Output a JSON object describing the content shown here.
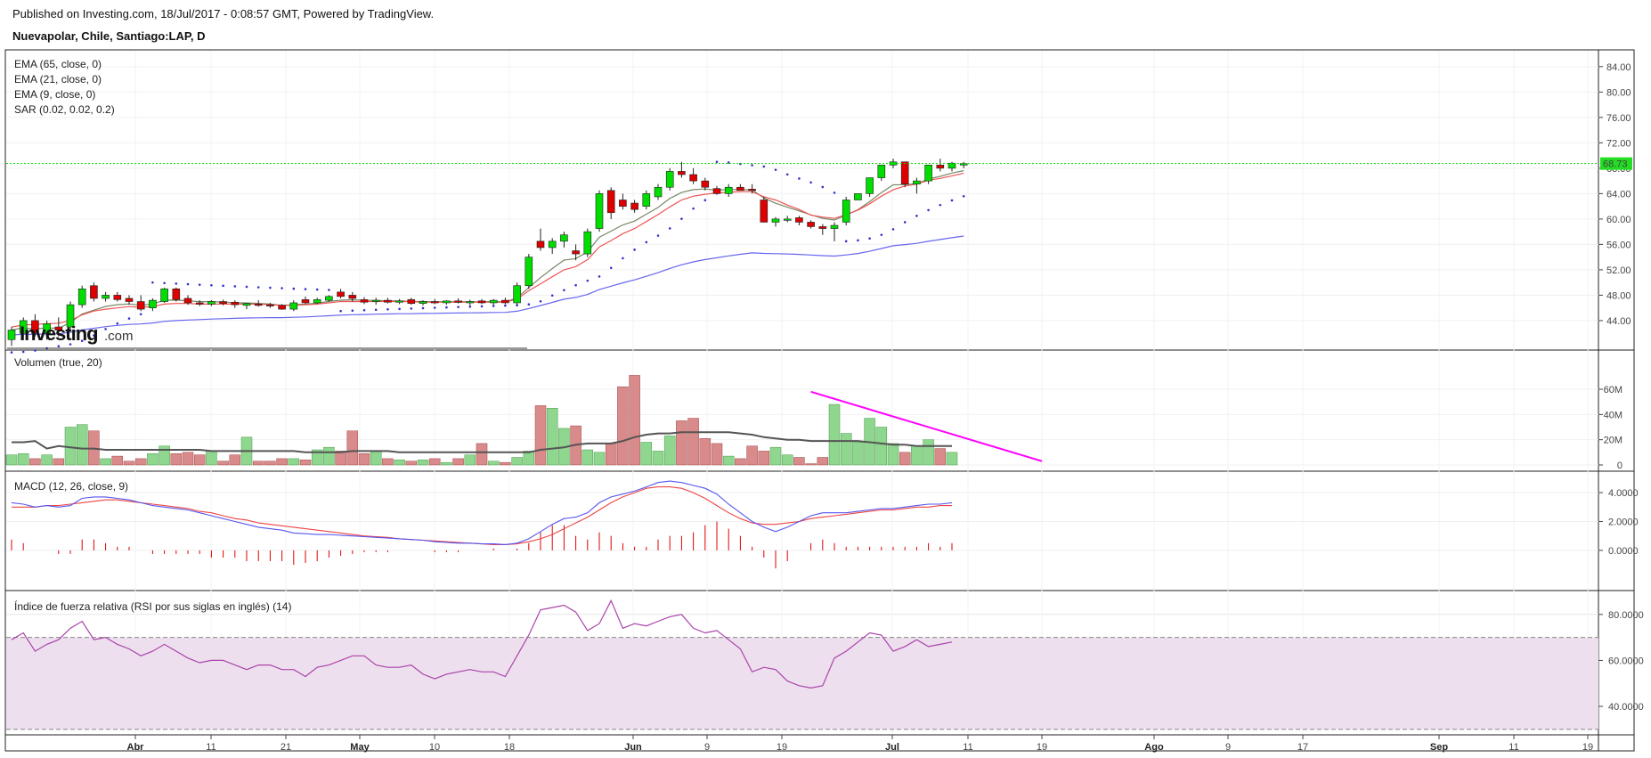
{
  "header": {
    "published": "Published on Investing.com, 18/Jul/2017 - 0:08:57 GMT, Powered by TradingView.",
    "instrument": "Nuevapolar, Chile, Santiago:LAP, D"
  },
  "logo": {
    "brand": "Investing",
    "suffix": ".com"
  },
  "colors": {
    "up": "#00dd00",
    "down": "#dd0000",
    "ema65": "#6666ee",
    "ema21": "#778866",
    "ema9": "#ee5555",
    "sar": "#3333cc",
    "vol_up": "#8fd68f",
    "vol_down": "#d98a8a",
    "vol_ma": "#555555",
    "trendline": "#ff00ff",
    "macd": "#5555ee",
    "signal": "#ee4444",
    "rsi": "#aa44aa",
    "rsi_band": "#eddfee",
    "last_price_bg": "#22dd22"
  },
  "chart_data": [
    {
      "type": "candlestick",
      "title": "Nuevapolar, Chile, Santiago:LAP, D",
      "legend": [
        "EMA (65, close, 0)",
        "EMA (21, close, 0)",
        "EMA (9, close, 0)",
        "SAR (0.02, 0.02, 0.2)"
      ],
      "y_ticks": [
        "84.00",
        "80.00",
        "76.00",
        "72.00",
        "68.00",
        "64.00",
        "60.00",
        "56.00",
        "52.00",
        "48.00",
        "44.00"
      ],
      "ylim": [
        39.5,
        86.5
      ],
      "last_price": 68.73,
      "last_price_label": "68.73",
      "candles": [
        {
          "o": 41,
          "h": 43,
          "l": 40,
          "c": 42.5
        },
        {
          "o": 42,
          "h": 44.5,
          "l": 41,
          "c": 44
        },
        {
          "o": 44,
          "h": 45,
          "l": 41.5,
          "c": 42
        },
        {
          "o": 42,
          "h": 44,
          "l": 41,
          "c": 43.5
        },
        {
          "o": 43,
          "h": 44.5,
          "l": 41.5,
          "c": 42.5
        },
        {
          "o": 43,
          "h": 47,
          "l": 42.5,
          "c": 46.5
        },
        {
          "o": 46.5,
          "h": 49.5,
          "l": 46,
          "c": 49
        },
        {
          "o": 49.5,
          "h": 50,
          "l": 47,
          "c": 47.5
        },
        {
          "o": 47.5,
          "h": 48.5,
          "l": 47,
          "c": 48
        },
        {
          "o": 48,
          "h": 48.5,
          "l": 47,
          "c": 47.3
        },
        {
          "o": 47.5,
          "h": 48,
          "l": 46.5,
          "c": 47
        },
        {
          "o": 47,
          "h": 48,
          "l": 45.5,
          "c": 45.8
        },
        {
          "o": 46,
          "h": 47.5,
          "l": 45.5,
          "c": 47.2
        },
        {
          "o": 47,
          "h": 49.2,
          "l": 46.8,
          "c": 49
        },
        {
          "o": 49,
          "h": 49.2,
          "l": 47,
          "c": 47.3
        },
        {
          "o": 47.5,
          "h": 48,
          "l": 46.5,
          "c": 46.8
        },
        {
          "o": 46.8,
          "h": 47.2,
          "l": 46.3,
          "c": 46.6
        },
        {
          "o": 46.6,
          "h": 47.2,
          "l": 46.3,
          "c": 47
        },
        {
          "o": 47,
          "h": 47.3,
          "l": 46.4,
          "c": 46.7
        },
        {
          "o": 46.9,
          "h": 47.2,
          "l": 46,
          "c": 46.5
        },
        {
          "o": 46.4,
          "h": 46.8,
          "l": 45.8,
          "c": 46.7
        },
        {
          "o": 46.6,
          "h": 47.2,
          "l": 46.2,
          "c": 46.5
        },
        {
          "o": 46.5,
          "h": 46.8,
          "l": 46,
          "c": 46.3
        },
        {
          "o": 46.4,
          "h": 46.6,
          "l": 45.7,
          "c": 45.8
        },
        {
          "o": 45.8,
          "h": 47.2,
          "l": 45.5,
          "c": 46.8
        },
        {
          "o": 47.3,
          "h": 47.8,
          "l": 46.6,
          "c": 46.8
        },
        {
          "o": 46.8,
          "h": 47.6,
          "l": 46.6,
          "c": 47.3
        },
        {
          "o": 47.2,
          "h": 48,
          "l": 47,
          "c": 47.8
        },
        {
          "o": 48.5,
          "h": 49,
          "l": 47.5,
          "c": 47.8
        },
        {
          "o": 48,
          "h": 48.5,
          "l": 47,
          "c": 47.5
        },
        {
          "o": 47.3,
          "h": 47.7,
          "l": 46.6,
          "c": 46.9
        },
        {
          "o": 47,
          "h": 47.6,
          "l": 46.5,
          "c": 47.2
        },
        {
          "o": 47.2,
          "h": 47.6,
          "l": 46.7,
          "c": 46.9
        },
        {
          "o": 47,
          "h": 47.4,
          "l": 46.6,
          "c": 47.1
        },
        {
          "o": 47.3,
          "h": 47.6,
          "l": 46.5,
          "c": 46.7
        },
        {
          "o": 46.7,
          "h": 47.2,
          "l": 46.4,
          "c": 47
        },
        {
          "o": 47,
          "h": 47.4,
          "l": 46.6,
          "c": 46.8
        },
        {
          "o": 46.8,
          "h": 47.2,
          "l": 46.5,
          "c": 47.1
        },
        {
          "o": 47.1,
          "h": 47.5,
          "l": 46.7,
          "c": 46.9
        },
        {
          "o": 46.8,
          "h": 47.3,
          "l": 46.4,
          "c": 47
        },
        {
          "o": 47.1,
          "h": 47.4,
          "l": 46.6,
          "c": 46.8
        },
        {
          "o": 46.8,
          "h": 47.4,
          "l": 46.5,
          "c": 47.2
        },
        {
          "o": 47.2,
          "h": 47.6,
          "l": 46.6,
          "c": 46.8
        },
        {
          "o": 46.8,
          "h": 50,
          "l": 46.5,
          "c": 49.5
        },
        {
          "o": 49.5,
          "h": 54.5,
          "l": 49,
          "c": 54
        },
        {
          "o": 56.5,
          "h": 58.5,
          "l": 55,
          "c": 55.5
        },
        {
          "o": 55.5,
          "h": 57,
          "l": 54.5,
          "c": 56.5
        },
        {
          "o": 56.5,
          "h": 58,
          "l": 55.5,
          "c": 57.5
        },
        {
          "o": 55,
          "h": 56,
          "l": 53.5,
          "c": 54.5
        },
        {
          "o": 54.5,
          "h": 58.5,
          "l": 54,
          "c": 58
        },
        {
          "o": 58.5,
          "h": 64.5,
          "l": 58,
          "c": 64
        },
        {
          "o": 64.5,
          "h": 65,
          "l": 60,
          "c": 61
        },
        {
          "o": 63,
          "h": 64,
          "l": 61.5,
          "c": 62
        },
        {
          "o": 62.5,
          "h": 63,
          "l": 61,
          "c": 61.5
        },
        {
          "o": 62,
          "h": 64.5,
          "l": 61.5,
          "c": 64
        },
        {
          "o": 63.5,
          "h": 65.5,
          "l": 63,
          "c": 65
        },
        {
          "o": 65,
          "h": 68,
          "l": 64.5,
          "c": 67.5
        },
        {
          "o": 67.5,
          "h": 69,
          "l": 66.5,
          "c": 67
        },
        {
          "o": 67,
          "h": 68,
          "l": 65.5,
          "c": 66
        },
        {
          "o": 66,
          "h": 66.5,
          "l": 64.5,
          "c": 65
        },
        {
          "o": 64.8,
          "h": 65.2,
          "l": 63.8,
          "c": 64
        },
        {
          "o": 64,
          "h": 65.5,
          "l": 63.5,
          "c": 65
        },
        {
          "o": 65,
          "h": 65.5,
          "l": 64.5,
          "c": 64.5
        },
        {
          "o": 64.7,
          "h": 65.5,
          "l": 64,
          "c": 64.5
        },
        {
          "o": 63,
          "h": 63.5,
          "l": 59.5,
          "c": 59.5
        },
        {
          "o": 59.5,
          "h": 60.3,
          "l": 58.8,
          "c": 60
        },
        {
          "o": 60,
          "h": 60.5,
          "l": 59.5,
          "c": 60
        },
        {
          "o": 60.2,
          "h": 60.5,
          "l": 59,
          "c": 59.5
        },
        {
          "o": 59.5,
          "h": 59.8,
          "l": 58.5,
          "c": 58.8
        },
        {
          "o": 58.8,
          "h": 59.2,
          "l": 57.5,
          "c": 58.5
        },
        {
          "o": 58.5,
          "h": 59.5,
          "l": 56.5,
          "c": 59
        },
        {
          "o": 59.5,
          "h": 63.5,
          "l": 59,
          "c": 63
        },
        {
          "o": 63,
          "h": 64,
          "l": 63,
          "c": 64
        },
        {
          "o": 64,
          "h": 66.5,
          "l": 63.5,
          "c": 66.5
        },
        {
          "o": 66.5,
          "h": 68.5,
          "l": 66,
          "c": 68.5
        },
        {
          "o": 68.5,
          "h": 69.5,
          "l": 68,
          "c": 69
        },
        {
          "o": 69,
          "h": 69,
          "l": 65,
          "c": 65.5
        },
        {
          "o": 65.5,
          "h": 66.5,
          "l": 64,
          "c": 66
        },
        {
          "o": 66,
          "h": 68.5,
          "l": 65.5,
          "c": 68.5
        },
        {
          "o": 68.5,
          "h": 69.5,
          "l": 67.5,
          "c": 68
        },
        {
          "o": 68,
          "h": 69,
          "l": 67.5,
          "c": 68.8
        },
        {
          "o": 68.5,
          "h": 69,
          "l": 68,
          "c": 68.73
        }
      ],
      "ema9": [
        43,
        43.3,
        43.4,
        43.5,
        43.6,
        44,
        44.9,
        45.5,
        45.8,
        46,
        46.2,
        46.1,
        46.2,
        46.6,
        46.7,
        46.7,
        46.6,
        46.6,
        46.6,
        46.6,
        46.6,
        46.6,
        46.5,
        46.4,
        46.4,
        46.5,
        46.6,
        46.8,
        47,
        47,
        47,
        47,
        47,
        47,
        47,
        46.9,
        46.9,
        46.9,
        46.9,
        46.9,
        46.9,
        46.9,
        46.9,
        47.4,
        48.7,
        49.8,
        50.9,
        52,
        52.5,
        53.6,
        55.6,
        56.6,
        57.7,
        58.5,
        59.6,
        60.7,
        61.9,
        63,
        63.6,
        63.9,
        64.1,
        64.2,
        64.3,
        64.3,
        63.5,
        63,
        62.2,
        61.5,
        60.6,
        60.3,
        60.1,
        60.7,
        61.4,
        62.4,
        63.6,
        64.6,
        65.2,
        65.5,
        66.1,
        66.4,
        66.8,
        67.2
      ]
    },
    {
      "type": "bar",
      "title": "Volumen (true, 20)",
      "y_ticks": [
        "60M",
        "40M",
        "20M",
        "0"
      ],
      "ylim": [
        0,
        72000000
      ],
      "values": [
        8,
        9,
        5,
        8,
        5,
        30,
        32,
        27,
        5,
        7,
        3,
        5,
        9,
        15,
        9,
        10,
        8,
        11,
        3,
        8,
        22,
        3,
        3,
        5,
        5,
        4,
        12,
        14,
        11,
        27,
        9,
        11,
        5,
        4,
        3,
        4,
        5,
        2,
        5,
        8,
        17,
        3,
        2,
        6,
        11,
        47,
        45,
        29,
        31,
        12,
        10,
        17,
        62,
        71,
        18,
        11,
        23,
        35,
        37,
        21,
        17,
        7,
        5,
        15,
        11,
        14,
        8,
        6,
        1,
        6,
        48,
        25,
        18,
        37,
        30,
        17,
        10,
        15,
        20,
        13,
        10
      ],
      "volume_ma": [
        18,
        18,
        19,
        13,
        15,
        14,
        13,
        13,
        12,
        12,
        12,
        12,
        12,
        12,
        12,
        12,
        12,
        11,
        11,
        11,
        11,
        11,
        11,
        11,
        11,
        10,
        10,
        10,
        10,
        11,
        11,
        11,
        11,
        10,
        10,
        10,
        10,
        10,
        10,
        10,
        10,
        10,
        10,
        10,
        10,
        12,
        13,
        14,
        16,
        17,
        17,
        17,
        19,
        22,
        24,
        25,
        25,
        26,
        26,
        26,
        26,
        26,
        25,
        24,
        22,
        21,
        20,
        20,
        19,
        19,
        19,
        19,
        19,
        18,
        17,
        16,
        16,
        15,
        15,
        15,
        15
      ],
      "trendline": {
        "from": 58,
        "to": 3
      }
    },
    {
      "type": "line",
      "title": "MACD (12, 26, close, 9)",
      "y_ticks": [
        "4.0000",
        "2.0000",
        "0.0000"
      ],
      "ylim": [
        -2.6,
        5.3
      ],
      "macd": [
        3.3,
        3.2,
        3.0,
        3.1,
        3.0,
        3.1,
        3.6,
        3.7,
        3.7,
        3.6,
        3.5,
        3.3,
        3.1,
        3.0,
        2.9,
        2.8,
        2.6,
        2.4,
        2.2,
        2.0,
        1.8,
        1.6,
        1.5,
        1.4,
        1.2,
        1.15,
        1.1,
        1.1,
        1.05,
        1.0,
        0.95,
        0.9,
        0.85,
        0.8,
        0.75,
        0.7,
        0.6,
        0.55,
        0.5,
        0.5,
        0.45,
        0.45,
        0.4,
        0.5,
        0.8,
        1.3,
        1.8,
        2.2,
        2.3,
        2.6,
        3.3,
        3.7,
        3.9,
        4.1,
        4.4,
        4.7,
        4.8,
        4.7,
        4.5,
        4.3,
        3.9,
        3.2,
        2.6,
        2.0,
        1.6,
        1.3,
        1.6,
        2.0,
        2.4,
        2.6,
        2.6,
        2.6,
        2.7,
        2.8,
        2.9,
        2.9,
        3.0,
        3.1,
        3.2,
        3.2,
        3.3
      ],
      "signal": [
        3.0,
        3.0,
        3.0,
        3.1,
        3.1,
        3.2,
        3.3,
        3.4,
        3.5,
        3.5,
        3.4,
        3.3,
        3.2,
        3.1,
        3.0,
        2.9,
        2.7,
        2.6,
        2.4,
        2.2,
        2.1,
        1.9,
        1.8,
        1.7,
        1.6,
        1.5,
        1.4,
        1.3,
        1.2,
        1.1,
        1.0,
        0.95,
        0.9,
        0.8,
        0.75,
        0.7,
        0.65,
        0.6,
        0.55,
        0.5,
        0.45,
        0.4,
        0.4,
        0.45,
        0.6,
        0.8,
        1.1,
        1.5,
        1.9,
        2.3,
        2.8,
        3.3,
        3.7,
        4.0,
        4.3,
        4.4,
        4.4,
        4.3,
        4.0,
        3.6,
        3.1,
        2.6,
        2.2,
        1.9,
        1.8,
        1.8,
        1.9,
        2.0,
        2.2,
        2.3,
        2.4,
        2.5,
        2.6,
        2.7,
        2.8,
        2.8,
        2.9,
        3.0,
        3.0,
        3.1,
        3.1
      ],
      "histogram": [
        0.3,
        0.2,
        0,
        0,
        -0.1,
        -0.1,
        0.3,
        0.3,
        0.2,
        0.1,
        0.1,
        0,
        -0.1,
        -0.1,
        -0.1,
        -0.1,
        -0.1,
        -0.2,
        -0.2,
        -0.2,
        -0.3,
        -0.3,
        -0.3,
        -0.3,
        -0.4,
        -0.35,
        -0.3,
        -0.2,
        -0.15,
        -0.1,
        -0.05,
        -0.05,
        -0.05,
        0,
        0,
        0,
        -0.05,
        -0.05,
        -0.05,
        0,
        0,
        0.05,
        0,
        0.05,
        0.2,
        0.5,
        0.7,
        0.7,
        0.4,
        0.3,
        0.5,
        0.4,
        0.2,
        0.1,
        0.1,
        0.3,
        0.4,
        0.4,
        0.5,
        0.7,
        0.8,
        0.6,
        0.4,
        0.1,
        -0.2,
        -0.5,
        -0.3,
        0,
        0.2,
        0.3,
        0.2,
        0.1,
        0.1,
        0.1,
        0.1,
        0.1,
        0.1,
        0.1,
        0.2,
        0.1,
        0.2
      ]
    },
    {
      "type": "line",
      "title": "Índice de fuerza relativa (RSI por sus siglas en inglés) (14)",
      "y_ticks": [
        "80.0000",
        "60.0000",
        "40.0000"
      ],
      "ylim": [
        28,
        90
      ],
      "upper_band": 70,
      "lower_band": 30,
      "values": [
        69,
        72,
        64,
        67,
        69,
        74,
        77,
        69,
        70,
        67,
        65,
        62,
        64,
        67,
        64,
        61,
        59,
        60,
        60,
        58,
        56,
        58,
        58,
        56,
        56,
        53,
        57,
        58,
        60,
        62,
        62,
        58,
        57,
        57,
        58,
        54,
        52,
        54,
        55,
        56,
        55,
        55,
        53,
        62,
        71,
        82,
        83,
        84,
        81,
        73,
        76,
        86,
        74,
        76,
        75,
        77,
        79,
        80,
        74,
        72,
        73,
        69,
        65,
        55,
        57,
        56,
        51,
        49,
        48,
        49,
        61,
        64,
        68,
        72,
        71,
        64,
        66,
        69,
        66,
        67,
        68
      ],
      "x_ticks": [
        "Abr",
        "11",
        "21",
        "May",
        "10",
        "18",
        "Jun",
        "9",
        "19",
        "Jul",
        "11",
        "19",
        "Ago",
        "9",
        "17",
        "Sep",
        "11",
        "19"
      ]
    }
  ]
}
